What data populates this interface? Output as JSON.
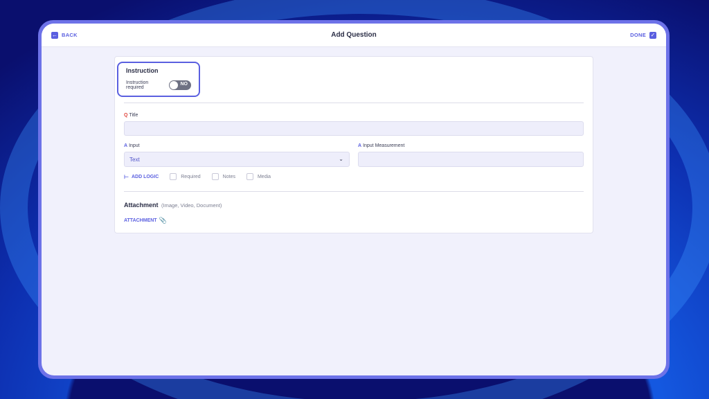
{
  "header": {
    "back_label": "BACK",
    "back_icon": "arrow-left-icon",
    "title": "Add Question",
    "done_label": "DONE",
    "done_icon": "check-icon"
  },
  "instruction": {
    "heading": "Instruction",
    "toggle_label": "Instruction required",
    "toggle_state": "NO"
  },
  "title_field": {
    "marker": "Q",
    "label": "Title",
    "value": ""
  },
  "input_field": {
    "marker": "A",
    "label": "Input",
    "value": "Text"
  },
  "measurement_field": {
    "marker": "A",
    "label": "Input Measurement",
    "value": ""
  },
  "options": {
    "add_logic_label": "ADD LOGIC",
    "required_label": "Required",
    "notes_label": "Notes",
    "media_label": "Media"
  },
  "attachment": {
    "heading": "Attachment",
    "subheading": "(Image, Video, Document)",
    "button_label": "ATTACHMENT"
  },
  "colors": {
    "accent": "#5a5fe0",
    "question_marker": "#e0463e",
    "frame": "#6d72e8"
  }
}
